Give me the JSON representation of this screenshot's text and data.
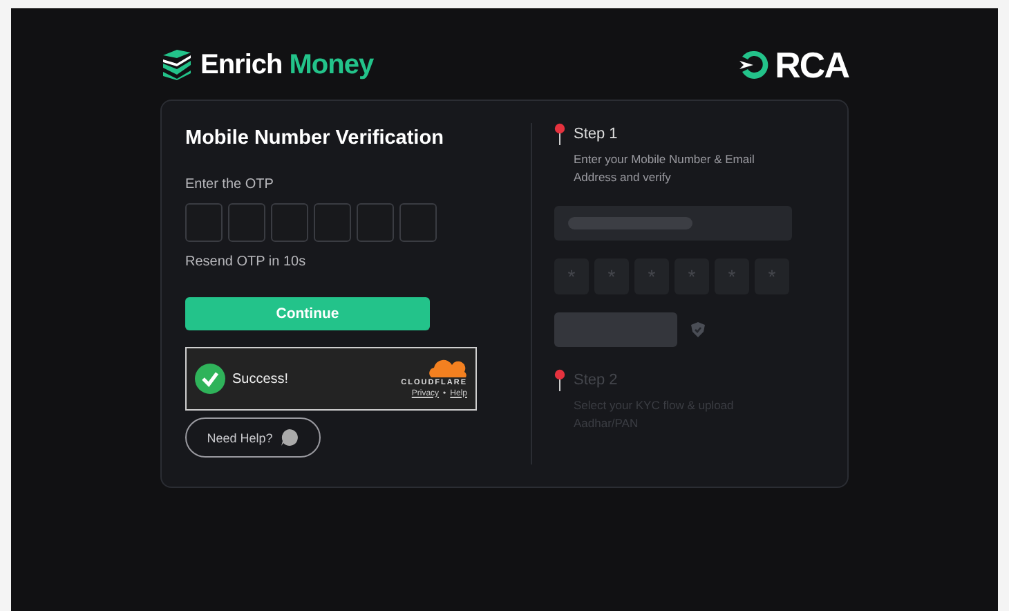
{
  "header": {
    "brand_left": {
      "word_1": "Enrich",
      "word_2": "Money"
    },
    "brand_right": {
      "text": "RCA"
    }
  },
  "form": {
    "title": "Mobile Number Verification",
    "otp_label": "Enter the OTP",
    "otp_boxes": [
      {
        "filled": false
      },
      {
        "filled": false
      },
      {
        "filled": false
      },
      {
        "filled": false
      },
      {
        "filled": false
      },
      {
        "filled": false
      }
    ],
    "resend": "Resend OTP in 10s",
    "continue_button": "Continue",
    "captcha": {
      "status": "Success!",
      "verified": true,
      "provider": "CLOUDFLARE",
      "links": [
        "Privacy",
        "Help"
      ],
      "separator": "•"
    },
    "help_button": "Need Help?"
  },
  "steps": [
    {
      "title": "Step 1",
      "description": "Enter your Mobile Number & Email Address and verify",
      "active": true
    },
    {
      "title": "Step 2",
      "description": "Select your KYC flow & upload Aadhar/PAN",
      "active": false
    }
  ],
  "preview": {
    "otp_masks": [
      "*",
      "*",
      "*",
      "*",
      "*",
      "*"
    ]
  }
}
